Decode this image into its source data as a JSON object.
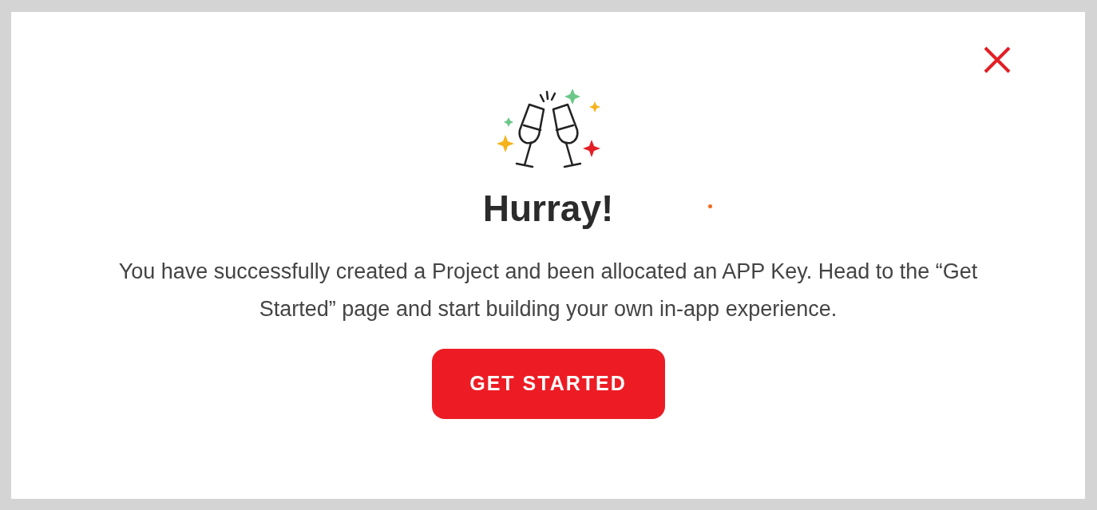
{
  "dialog": {
    "title": "Hurray!",
    "message": "You have successfully created a Project and been allocated an APP Key. Head to the “Get Started” page and start building your own in-app experience.",
    "button": "GET STARTED"
  }
}
